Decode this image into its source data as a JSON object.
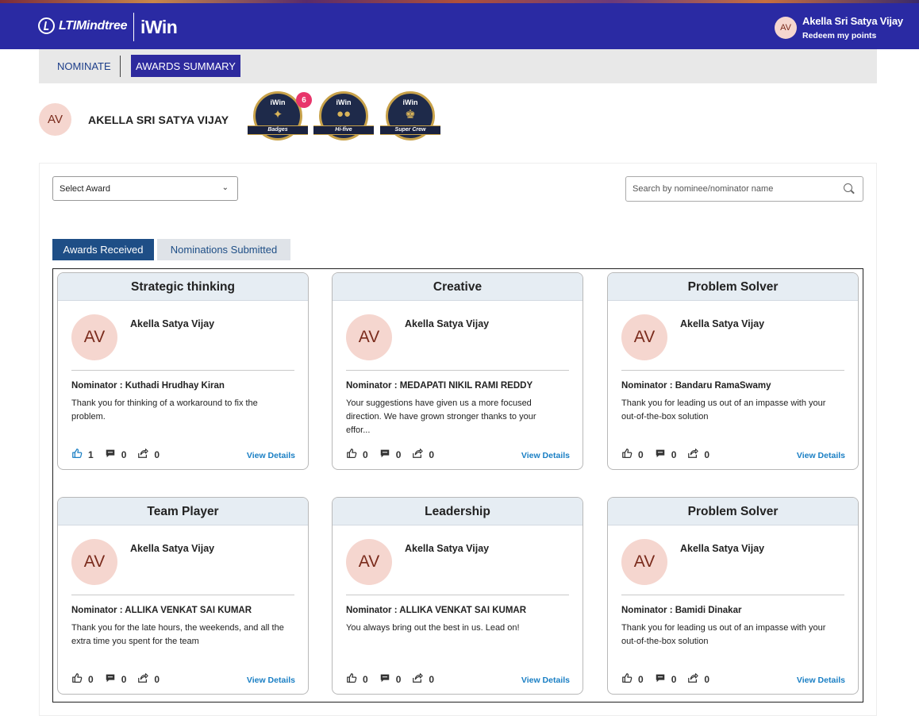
{
  "header": {
    "brand": "LTIMindtree",
    "product": "iWin",
    "user_initials": "AV",
    "user_name": "Akella Sri Satya Vijay",
    "redeem_label": "Redeem my points"
  },
  "tabs": {
    "nominate": "NOMINATE",
    "awards_summary": "AWARDS SUMMARY"
  },
  "profile": {
    "initials": "AV",
    "name": "AKELLA SRI SATYA VIJAY"
  },
  "badges": [
    {
      "label": "Badges",
      "logo": "iWin"
    },
    {
      "label": "Hi-five",
      "logo": "iWin"
    },
    {
      "label": "Super Crew",
      "logo": "iWin"
    }
  ],
  "badge_count": "6",
  "filters": {
    "select_award": "Select Award",
    "search_placeholder": "Search by nominee/nominator name"
  },
  "subtabs": {
    "received": "Awards Received",
    "submitted": "Nominations Submitted"
  },
  "cards": [
    {
      "title": "Strategic thinking",
      "initials": "AV",
      "nominee": "Akella Satya Vijay",
      "nominator": "Nominator : Kuthadi Hrudhay Kiran",
      "message": "Thank you for thinking of a workaround to fix the problem.",
      "likes": "1",
      "comments": "0",
      "shares": "0",
      "liked": true,
      "view": "View Details"
    },
    {
      "title": "Creative",
      "initials": "AV",
      "nominee": "Akella Satya Vijay",
      "nominator": "Nominator : MEDAPATI NIKIL RAMI REDDY",
      "message": "Your suggestions have given us a more focused direction. We have grown stronger thanks to your effor...",
      "likes": "0",
      "comments": "0",
      "shares": "0",
      "liked": false,
      "view": "View Details"
    },
    {
      "title": "Problem Solver",
      "initials": "AV",
      "nominee": "Akella Satya Vijay",
      "nominator": "Nominator : Bandaru RamaSwamy",
      "message": "Thank you for leading us out of an impasse with your out-of-the-box solution",
      "likes": "0",
      "comments": "0",
      "shares": "0",
      "liked": false,
      "view": "View Details"
    },
    {
      "title": "Team Player",
      "initials": "AV",
      "nominee": "Akella Satya Vijay",
      "nominator": "Nominator : ALLIKA VENKAT SAI KUMAR",
      "message": "Thank you for the late hours, the weekends, and all the extra time you spent for the team",
      "likes": "0",
      "comments": "0",
      "shares": "0",
      "liked": false,
      "view": "View Details"
    },
    {
      "title": "Leadership",
      "initials": "AV",
      "nominee": "Akella Satya Vijay",
      "nominator": "Nominator : ALLIKA VENKAT SAI KUMAR",
      "message": "You always bring out the best in us. Lead on!",
      "likes": "0",
      "comments": "0",
      "shares": "0",
      "liked": false,
      "view": "View Details"
    },
    {
      "title": "Problem Solver",
      "initials": "AV",
      "nominee": "Akella Satya Vijay",
      "nominator": "Nominator : Bamidi Dinakar",
      "message": "Thank you for leading us out of an impasse with your out-of-the-box solution",
      "likes": "0",
      "comments": "0",
      "shares": "0",
      "liked": false,
      "view": "View Details"
    }
  ],
  "colors": {
    "header_bg": "#2a2aa3",
    "accent": "#1e4e86",
    "liked": "#1a7fc4",
    "badge_count": "#e8356b"
  }
}
